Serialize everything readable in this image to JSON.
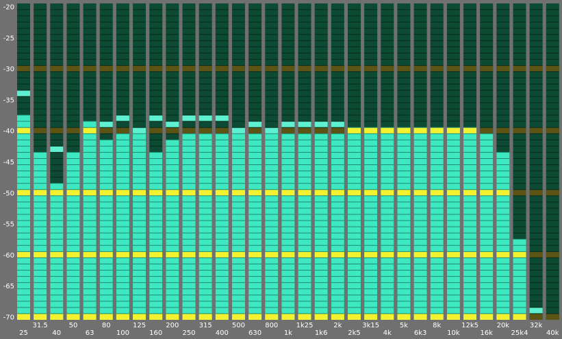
{
  "chart_data": {
    "type": "bar",
    "title": "",
    "xlabel": "",
    "ylabel": "",
    "ylim": [
      -70.5,
      -19.5
    ],
    "y_ticks": [
      -20,
      -25,
      -30,
      -35,
      -40,
      -45,
      -50,
      -55,
      -60,
      -65,
      -70
    ],
    "y_tick_labels": [
      "-20",
      "-25",
      "-30",
      "-35",
      "-40",
      "-45",
      "-50",
      "-55",
      "-60",
      "-65",
      "-70"
    ],
    "highlight_levels": [
      -30,
      -40,
      -50,
      -60,
      -70
    ],
    "categories": [
      "25",
      "31.5",
      "40",
      "50",
      "63",
      "80",
      "100",
      "125",
      "160",
      "200",
      "250",
      "315",
      "400",
      "500",
      "630",
      "800",
      "1k",
      "1k25",
      "1k6",
      "2k",
      "2k5",
      "3k15",
      "4k",
      "5k",
      "6k3",
      "8k",
      "10k",
      "12k5",
      "16k",
      "20k",
      "25k4",
      "32k",
      "40k"
    ],
    "values": [
      -37.5,
      -43.5,
      -48.5,
      -43.5,
      -38.5,
      -41.5,
      -40.5,
      -40.5,
      -43.5,
      -41.5,
      -40.5,
      -40.5,
      -40.5,
      -40.5,
      -40.5,
      -40.5,
      -40.5,
      -40.5,
      -40.5,
      -40.5,
      -39.5,
      -39.5,
      -39.5,
      -39.5,
      -39.5,
      -39.5,
      -39.5,
      -39.5,
      -40.5,
      -43.5,
      -57.5,
      -70.5,
      -70.5
    ],
    "peaks": [
      -33.5,
      -43.5,
      -42.5,
      -43.5,
      -38.5,
      -38.5,
      -37.5,
      -39.5,
      -37.5,
      -38.5,
      -37.5,
      -37.5,
      -37.5,
      -39.5,
      -38.5,
      -39.5,
      -38.5,
      -38.5,
      -38.5,
      -38.5,
      -39.5,
      -39.5,
      -39.5,
      -39.5,
      -39.5,
      -39.5,
      -39.5,
      -39.5,
      -40.5,
      -43.5,
      -57.5,
      -68.5,
      -70.5
    ],
    "colors": {
      "background": "#707070",
      "column_bg": "#0c4a34",
      "column_grid": "#082a1c",
      "bar": "#3ee8c0",
      "bar_grid": "#1f8a70",
      "peak": "#5ef0d0",
      "line_bg": "#5c5414",
      "line_bar": "#f2f230",
      "tick_text": "#ffffff"
    }
  }
}
